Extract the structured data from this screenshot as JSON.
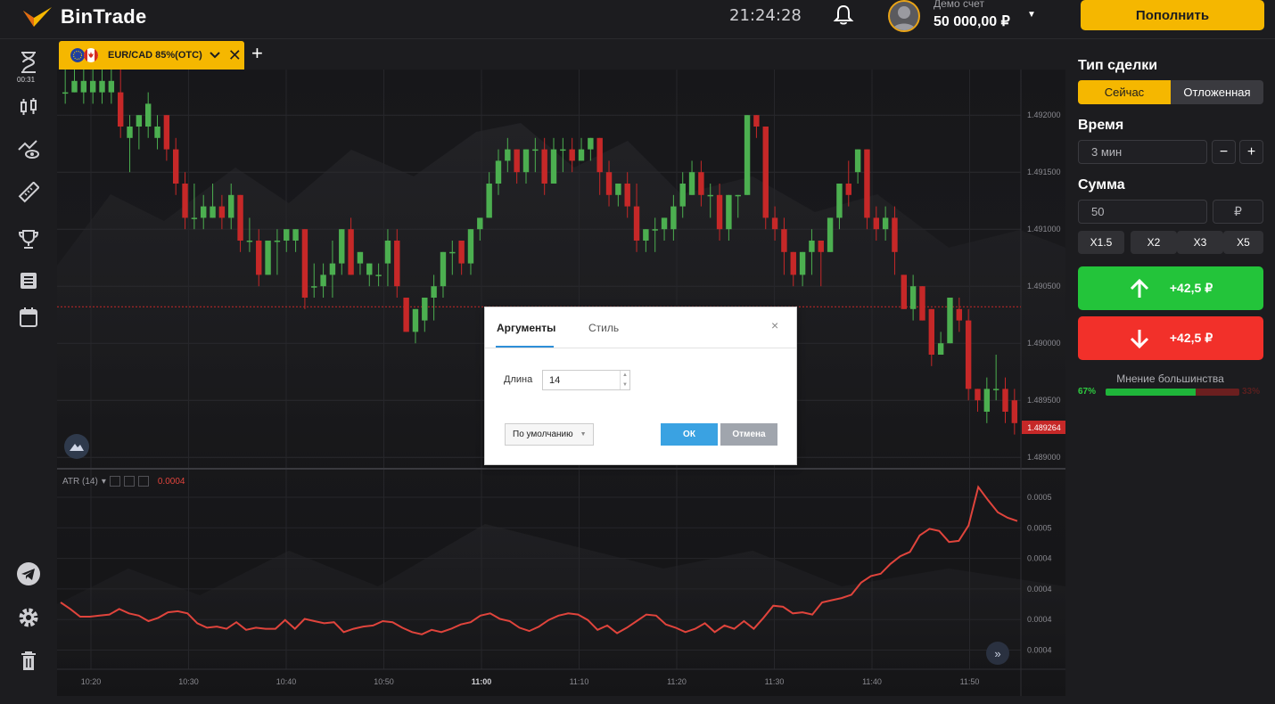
{
  "app": {
    "name": "BinTrade"
  },
  "header": {
    "clock": "21:24:28",
    "account_label": "Демо счет",
    "balance": "50 000,00 ₽",
    "deposit_label": "Пополнить"
  },
  "sidebar": {
    "timer": "00:31"
  },
  "tab": {
    "asset": "EUR/CAD 85%(OTC)"
  },
  "chart": {
    "price_ticks": [
      "1.492000",
      "1.491500",
      "1.491000",
      "1.490500",
      "1.490000",
      "1.489500",
      "1.489000"
    ],
    "current_price": "1.489264",
    "atr_ticks": [
      "0.0005",
      "0.0005",
      "0.0004",
      "0.0004",
      "0.0004",
      "0.0004"
    ],
    "time_ticks": [
      "10:20",
      "10:30",
      "10:40",
      "10:50",
      "11:00",
      "11:10",
      "11:20",
      "11:30",
      "11:40",
      "11:50"
    ],
    "atr_label": "ATR (14)",
    "atr_value": "0.0004"
  },
  "chart_data": {
    "type": "candlestick",
    "price_range": [
      1.4889,
      1.4924
    ],
    "atr_range": [
      0.00036,
      0.00054
    ],
    "candles": [
      {
        "o": 1.4922,
        "c": 1.4922,
        "h": 1.4924,
        "l": 1.4921
      },
      {
        "o": 1.4922,
        "c": 1.4923,
        "h": 1.4925,
        "l": 1.4922
      },
      {
        "o": 1.4922,
        "c": 1.4923,
        "h": 1.4924,
        "l": 1.4921
      },
      {
        "o": 1.4922,
        "c": 1.4923,
        "h": 1.4924,
        "l": 1.4921
      },
      {
        "o": 1.4922,
        "c": 1.4923,
        "h": 1.4924,
        "l": 1.4921
      },
      {
        "o": 1.4922,
        "c": 1.4923,
        "h": 1.4924,
        "l": 1.4921
      },
      {
        "o": 1.4922,
        "c": 1.4919,
        "h": 1.4925,
        "l": 1.4918
      },
      {
        "o": 1.4918,
        "c": 1.4919,
        "h": 1.492,
        "l": 1.4915
      },
      {
        "o": 1.4919,
        "c": 1.492,
        "h": 1.492,
        "l": 1.4917
      },
      {
        "o": 1.4919,
        "c": 1.4921,
        "h": 1.4922,
        "l": 1.4918
      },
      {
        "o": 1.4918,
        "c": 1.4919,
        "h": 1.492,
        "l": 1.4917
      },
      {
        "o": 1.492,
        "c": 1.4917,
        "h": 1.492,
        "l": 1.4916
      },
      {
        "o": 1.4917,
        "c": 1.4914,
        "h": 1.4918,
        "l": 1.4913
      },
      {
        "o": 1.4914,
        "c": 1.4911,
        "h": 1.4915,
        "l": 1.491
      },
      {
        "o": 1.4911,
        "c": 1.4911,
        "h": 1.4914,
        "l": 1.491
      },
      {
        "o": 1.4911,
        "c": 1.4912,
        "h": 1.4913,
        "l": 1.491
      },
      {
        "o": 1.4911,
        "c": 1.4912,
        "h": 1.4914,
        "l": 1.4911
      },
      {
        "o": 1.4912,
        "c": 1.4911,
        "h": 1.4913,
        "l": 1.491
      },
      {
        "o": 1.4911,
        "c": 1.4913,
        "h": 1.4914,
        "l": 1.491
      },
      {
        "o": 1.4913,
        "c": 1.4909,
        "h": 1.4913,
        "l": 1.4908
      },
      {
        "o": 1.4909,
        "c": 1.4909,
        "h": 1.4911,
        "l": 1.4908
      },
      {
        "o": 1.4909,
        "c": 1.4906,
        "h": 1.491,
        "l": 1.4905
      },
      {
        "o": 1.4906,
        "c": 1.4909,
        "h": 1.4909,
        "l": 1.4906
      },
      {
        "o": 1.4909,
        "c": 1.4909,
        "h": 1.491,
        "l": 1.4906
      },
      {
        "o": 1.4909,
        "c": 1.491,
        "h": 1.491,
        "l": 1.4908
      },
      {
        "o": 1.4909,
        "c": 1.491,
        "h": 1.491,
        "l": 1.4908
      },
      {
        "o": 1.491,
        "c": 1.4904,
        "h": 1.491,
        "l": 1.4903
      },
      {
        "o": 1.4905,
        "c": 1.4905,
        "h": 1.4907,
        "l": 1.4904
      },
      {
        "o": 1.4905,
        "c": 1.4906,
        "h": 1.4907,
        "l": 1.4904
      },
      {
        "o": 1.4906,
        "c": 1.4907,
        "h": 1.4909,
        "l": 1.4904
      },
      {
        "o": 1.4907,
        "c": 1.491,
        "h": 1.491,
        "l": 1.4906
      },
      {
        "o": 1.491,
        "c": 1.4906,
        "h": 1.4911,
        "l": 1.4906
      },
      {
        "o": 1.4907,
        "c": 1.4908,
        "h": 1.4908,
        "l": 1.4906
      },
      {
        "o": 1.4906,
        "c": 1.4907,
        "h": 1.4907,
        "l": 1.4905
      },
      {
        "o": 1.4906,
        "c": 1.4906,
        "h": 1.4907,
        "l": 1.4905
      },
      {
        "o": 1.4907,
        "c": 1.4909,
        "h": 1.491,
        "l": 1.4905
      },
      {
        "o": 1.4909,
        "c": 1.4905,
        "h": 1.491,
        "l": 1.4904
      },
      {
        "o": 1.4904,
        "c": 1.4901,
        "h": 1.4904,
        "l": 1.4901
      },
      {
        "o": 1.4901,
        "c": 1.4903,
        "h": 1.4903,
        "l": 1.49
      },
      {
        "o": 1.4902,
        "c": 1.4904,
        "h": 1.4904,
        "l": 1.4901
      },
      {
        "o": 1.4904,
        "c": 1.4905,
        "h": 1.4906,
        "l": 1.4902
      },
      {
        "o": 1.4905,
        "c": 1.4908,
        "h": 1.4908,
        "l": 1.4904
      },
      {
        "o": 1.4908,
        "c": 1.4908,
        "h": 1.4909,
        "l": 1.4906
      },
      {
        "o": 1.4909,
        "c": 1.4907,
        "h": 1.4909,
        "l": 1.4906
      },
      {
        "o": 1.4907,
        "c": 1.491,
        "h": 1.491,
        "l": 1.4906
      },
      {
        "o": 1.491,
        "c": 1.4911,
        "h": 1.4911,
        "l": 1.4909
      },
      {
        "o": 1.4911,
        "c": 1.4914,
        "h": 1.4915,
        "l": 1.4911
      },
      {
        "o": 1.4914,
        "c": 1.4916,
        "h": 1.4917,
        "l": 1.4913
      },
      {
        "o": 1.4916,
        "c": 1.4917,
        "h": 1.4918,
        "l": 1.4915
      },
      {
        "o": 1.4917,
        "c": 1.4915,
        "h": 1.4917,
        "l": 1.4914
      },
      {
        "o": 1.4915,
        "c": 1.4917,
        "h": 1.4917,
        "l": 1.4914
      },
      {
        "o": 1.4917,
        "c": 1.4917,
        "h": 1.4918,
        "l": 1.4915
      },
      {
        "o": 1.4917,
        "c": 1.4914,
        "h": 1.4918,
        "l": 1.4913
      },
      {
        "o": 1.4914,
        "c": 1.4917,
        "h": 1.4918,
        "l": 1.4914
      },
      {
        "o": 1.4917,
        "c": 1.4917,
        "h": 1.4918,
        "l": 1.4915
      },
      {
        "o": 1.4917,
        "c": 1.4916,
        "h": 1.4918,
        "l": 1.4915
      },
      {
        "o": 1.4916,
        "c": 1.4917,
        "h": 1.4918,
        "l": 1.4916
      },
      {
        "o": 1.4917,
        "c": 1.4918,
        "h": 1.4918,
        "l": 1.4916
      },
      {
        "o": 1.4918,
        "c": 1.4915,
        "h": 1.4918,
        "l": 1.4913
      },
      {
        "o": 1.4915,
        "c": 1.4913,
        "h": 1.4916,
        "l": 1.4912
      },
      {
        "o": 1.4913,
        "c": 1.4914,
        "h": 1.4914,
        "l": 1.4912
      },
      {
        "o": 1.4914,
        "c": 1.4912,
        "h": 1.4915,
        "l": 1.4911
      },
      {
        "o": 1.4912,
        "c": 1.4909,
        "h": 1.4914,
        "l": 1.4908
      },
      {
        "o": 1.4909,
        "c": 1.491,
        "h": 1.491,
        "l": 1.4908
      },
      {
        "o": 1.491,
        "c": 1.491,
        "h": 1.4911,
        "l": 1.4908
      },
      {
        "o": 1.491,
        "c": 1.4911,
        "h": 1.4911,
        "l": 1.4909
      },
      {
        "o": 1.491,
        "c": 1.4912,
        "h": 1.4913,
        "l": 1.4909
      },
      {
        "o": 1.4912,
        "c": 1.4914,
        "h": 1.4915,
        "l": 1.4911
      },
      {
        "o": 1.4913,
        "c": 1.4915,
        "h": 1.4916,
        "l": 1.4913
      },
      {
        "o": 1.4915,
        "c": 1.4913,
        "h": 1.4916,
        "l": 1.4912
      },
      {
        "o": 1.4913,
        "c": 1.4913,
        "h": 1.4914,
        "l": 1.4911
      },
      {
        "o": 1.4913,
        "c": 1.491,
        "h": 1.4914,
        "l": 1.4909
      },
      {
        "o": 1.491,
        "c": 1.4913,
        "h": 1.4913,
        "l": 1.4909
      },
      {
        "o": 1.4913,
        "c": 1.4913,
        "h": 1.4913,
        "l": 1.4911
      },
      {
        "o": 1.4913,
        "c": 1.492,
        "h": 1.492,
        "l": 1.4913
      },
      {
        "o": 1.492,
        "c": 1.4919,
        "h": 1.492,
        "l": 1.4918
      },
      {
        "o": 1.4919,
        "c": 1.4911,
        "h": 1.4919,
        "l": 1.491
      },
      {
        "o": 1.4911,
        "c": 1.491,
        "h": 1.4912,
        "l": 1.4909
      },
      {
        "o": 1.491,
        "c": 1.4908,
        "h": 1.4911,
        "l": 1.4906
      },
      {
        "o": 1.4908,
        "c": 1.4906,
        "h": 1.4908,
        "l": 1.4905
      },
      {
        "o": 1.4906,
        "c": 1.4908,
        "h": 1.4908,
        "l": 1.4905
      },
      {
        "o": 1.4908,
        "c": 1.4909,
        "h": 1.491,
        "l": 1.4906
      },
      {
        "o": 1.4909,
        "c": 1.4908,
        "h": 1.4909,
        "l": 1.4905
      },
      {
        "o": 1.4908,
        "c": 1.4911,
        "h": 1.4911,
        "l": 1.4908
      },
      {
        "o": 1.4911,
        "c": 1.4914,
        "h": 1.4914,
        "l": 1.491
      },
      {
        "o": 1.4914,
        "c": 1.4913,
        "h": 1.4916,
        "l": 1.4912
      },
      {
        "o": 1.4915,
        "c": 1.4917,
        "h": 1.4917,
        "l": 1.4914
      },
      {
        "o": 1.4917,
        "c": 1.4911,
        "h": 1.4917,
        "l": 1.491
      },
      {
        "o": 1.4911,
        "c": 1.491,
        "h": 1.4912,
        "l": 1.4909
      },
      {
        "o": 1.491,
        "c": 1.4911,
        "h": 1.4912,
        "l": 1.4909
      },
      {
        "o": 1.4911,
        "c": 1.4908,
        "h": 1.4912,
        "l": 1.4906
      },
      {
        "o": 1.4906,
        "c": 1.4903,
        "h": 1.4906,
        "l": 1.4903
      },
      {
        "o": 1.4903,
        "c": 1.4905,
        "h": 1.4906,
        "l": 1.4902
      },
      {
        "o": 1.4905,
        "c": 1.4902,
        "h": 1.4905,
        "l": 1.4902
      },
      {
        "o": 1.4903,
        "c": 1.4899,
        "h": 1.4903,
        "l": 1.4898
      },
      {
        "o": 1.4899,
        "c": 1.49,
        "h": 1.4901,
        "l": 1.4899
      },
      {
        "o": 1.49,
        "c": 1.4904,
        "h": 1.4904,
        "l": 1.49
      },
      {
        "o": 1.4903,
        "c": 1.4902,
        "h": 1.4904,
        "l": 1.4901
      },
      {
        "o": 1.4902,
        "c": 1.4896,
        "h": 1.4903,
        "l": 1.4895
      },
      {
        "o": 1.4896,
        "c": 1.4895,
        "h": 1.4896,
        "l": 1.4894
      },
      {
        "o": 1.4894,
        "c": 1.4896,
        "h": 1.4897,
        "l": 1.4893
      },
      {
        "o": 1.4896,
        "c": 1.4896,
        "h": 1.4899,
        "l": 1.4895
      },
      {
        "o": 1.4896,
        "c": 1.4894,
        "h": 1.4897,
        "l": 1.4893
      },
      {
        "o": 1.4895,
        "c": 1.4893,
        "h": 1.4896,
        "l": 1.4892
      }
    ],
    "atr": [
      0.00042,
      0.000414,
      0.000407,
      0.000407,
      0.000408,
      0.000409,
      0.000414,
      0.00041,
      0.000408,
      0.000403,
      0.000406,
      0.000411,
      0.000412,
      0.00041,
      0.000401,
      0.000397,
      0.000398,
      0.000396,
      0.000402,
      0.000395,
      0.000397,
      0.000396,
      0.000396,
      0.000404,
      0.000396,
      0.000405,
      0.000403,
      0.000401,
      0.000402,
      0.000393,
      0.000396,
      0.000398,
      0.000399,
      0.000403,
      0.000402,
      0.000397,
      0.000393,
      0.000391,
      0.000395,
      0.000393,
      0.000396,
      0.0004,
      0.000402,
      0.000408,
      0.00041,
      0.000405,
      0.000403,
      0.000397,
      0.000394,
      0.000398,
      0.000404,
      0.000408,
      0.00041,
      0.000409,
      0.000404,
      0.000395,
      0.000399,
      0.000392,
      0.000397,
      0.000403,
      0.000409,
      0.000408,
      0.0004,
      0.000397,
      0.000393,
      0.000396,
      0.000401,
      0.000393,
      0.000399,
      0.000396,
      0.000403,
      0.000396,
      0.000406,
      0.000417,
      0.000416,
      0.00041,
      0.000411,
      0.000409,
      0.00042,
      0.000422,
      0.000424,
      0.000427,
      0.000438,
      0.000444,
      0.000446,
      0.000455,
      0.000462,
      0.000466,
      0.000481,
      0.000487,
      0.000485,
      0.000475,
      0.000476,
      0.00049,
      0.000525,
      0.000513,
      0.000502,
      0.000497,
      0.000494
    ]
  },
  "modal": {
    "tab_args": "Аргументы",
    "tab_style": "Стиль",
    "close": "×",
    "length_label": "Длина",
    "length_value": "14",
    "defaults_label": "По умолчанию",
    "ok_label": "ОК",
    "cancel_label": "Отмена"
  },
  "panel": {
    "deal_type_title": "Тип сделки",
    "type_now": "Сейчас",
    "type_pending": "Отложенная",
    "time_title": "Время",
    "time_value": "3 мин",
    "minus": "−",
    "plus": "+",
    "amount_title": "Сумма",
    "amount_value": "50",
    "currency": "₽",
    "multipliers": [
      "X1.5",
      "X2",
      "X3",
      "X5"
    ],
    "up_label": "+42,5 ₽",
    "down_label": "+42,5 ₽",
    "majority_title": "Мнение большинства",
    "majority_up_pct": "67%",
    "majority_down_pct": "33%",
    "majority_up_fraction": 0.67
  },
  "colors": {
    "brand": "#f5b700",
    "up": "#23c43a",
    "down": "#f2302a",
    "bull_candle": "#4caf50",
    "bear_candle": "#c62828",
    "atr_line": "#e0443c"
  }
}
